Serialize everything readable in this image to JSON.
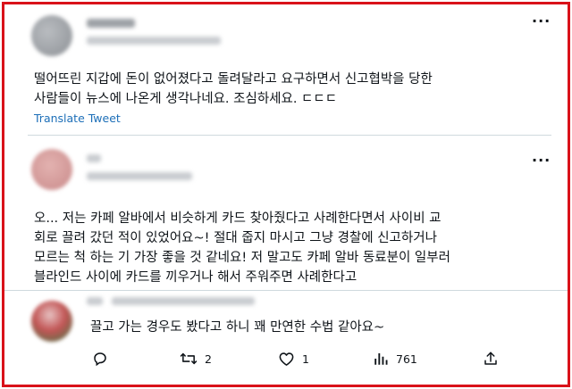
{
  "tweet1": {
    "text_line1": "떨어뜨린 지갑에 돈이 없어졌다고 돌려달라고 요구하면서 신고협박을 당한",
    "text_line2": "사람들이 뉴스에 나온게 생각나네요. 조심하세요. ㄷㄷㄷ",
    "translate_label": "Translate Tweet",
    "more_label": "···"
  },
  "reply1": {
    "text_line1": "오... 저는 카페 알바에서 비슷하게 카드 찾아줬다고 사례한다면서 사이비 교",
    "text_line2": "회로 끌려 갔던 적이 있었어요~! 절대 줍지 마시고 그냥 경찰에 신고하거나",
    "text_line3": "모르는 척 하는 기 가장 좋을 것 같네요! 저 말고도 카페 알바 동료분이 일부러",
    "text_line4": "블라인드 사이에 카드를 끼우거나 해서 주워주면 사례한다고",
    "more_label": "···"
  },
  "reply2": {
    "text": "끌고 가는 경우도 봤다고 하니 꽤 만연한 수법 같아요~"
  },
  "actions": {
    "reply_icon": "reply-icon",
    "retweet_icon": "retweet-icon",
    "retweet_count": "2",
    "like_icon": "heart-icon",
    "like_count": "1",
    "views_icon": "views-icon",
    "views_count": "761",
    "share_icon": "share-icon"
  },
  "colors": {
    "border": "#d9121a",
    "link": "#1d6fb8",
    "text": "#0f1419",
    "divider": "#cfd9de"
  }
}
